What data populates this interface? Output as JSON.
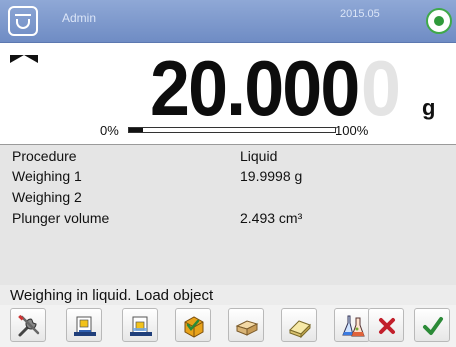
{
  "top_bar": {
    "user": "Admin",
    "mode": "",
    "date": "2015.05",
    "time": "",
    "level_icon": "level-indicator-icon"
  },
  "display": {
    "weight": "20.000",
    "weight_ghost_digit": "0",
    "unit": "g",
    "bargraph_min_label": "0%",
    "bargraph_max_label": "100%",
    "bargraph_level": 0.07
  },
  "info": {
    "rows": [
      {
        "label": "Procedure",
        "value": "Liquid"
      },
      {
        "label": "Weighing 1",
        "value": "19.9998 g"
      },
      {
        "label": "Weighing 2",
        "value": ""
      },
      {
        "label": "Plunger volume",
        "value": "2.493 cm³"
      }
    ]
  },
  "status": {
    "message": "Weighing in liquid. Load object"
  },
  "buttons": [
    {
      "name": "settings-tools-icon"
    },
    {
      "name": "weighing-1-icon"
    },
    {
      "name": "weighing-2-icon"
    },
    {
      "name": "box-check-icon"
    },
    {
      "name": "sample-block-icon"
    },
    {
      "name": "eraser-icon"
    },
    {
      "name": "flasks-icon"
    },
    {
      "name": "cancel-x-icon"
    },
    {
      "name": "confirm-check-icon"
    }
  ],
  "colors": {
    "top_bar": "#7f99cd",
    "cancel": "#c21f2b",
    "confirm": "#2b8a37",
    "info_panel": "#e5e5e5"
  }
}
